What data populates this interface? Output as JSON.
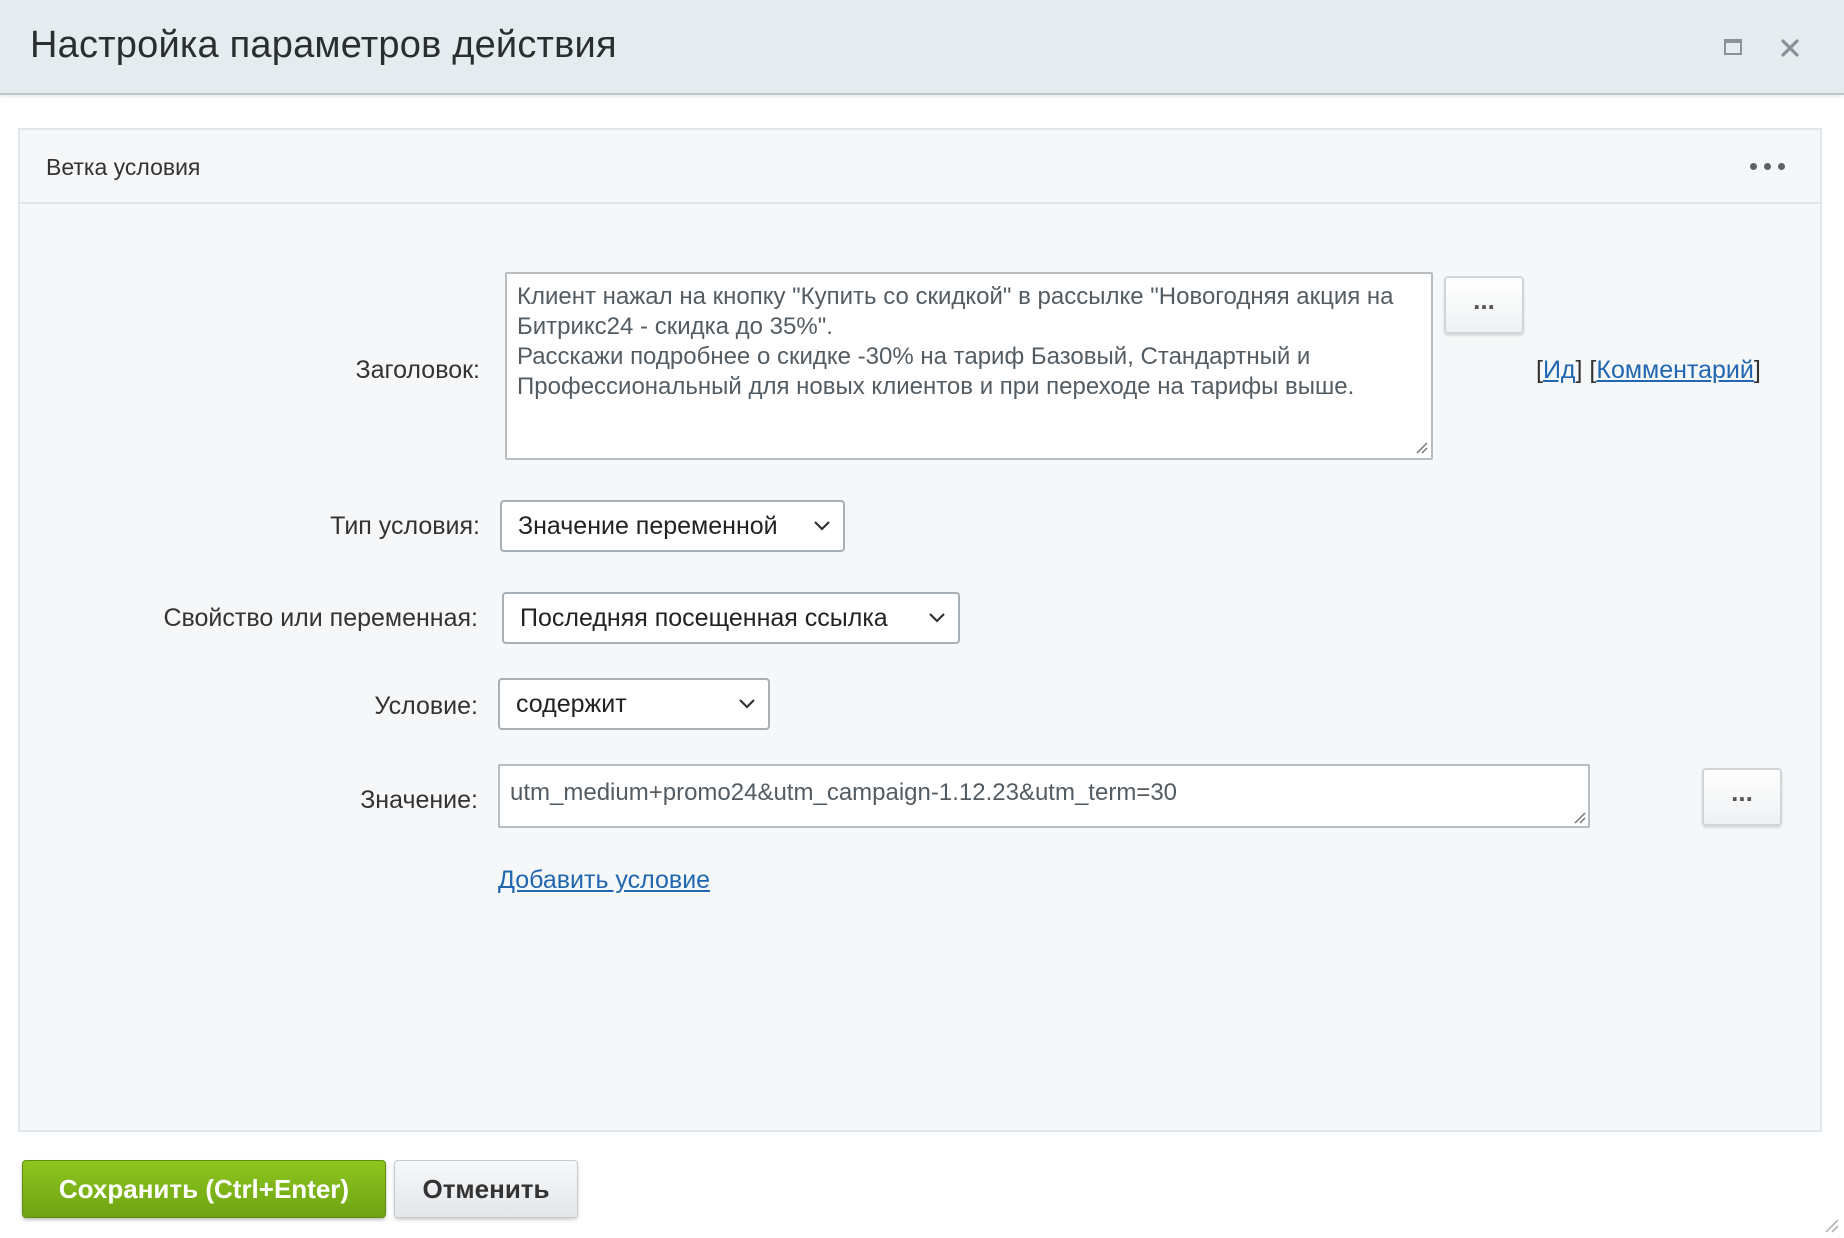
{
  "dialog": {
    "title": "Настройка параметров действия"
  },
  "panel": {
    "title": "Ветка условия"
  },
  "form": {
    "heading_label": "Заголовок:",
    "heading_value": "Клиент нажал на кнопку \"Купить со скидкой\" в рассылке \"Новогодняя акция на Битрикс24 - скидка до 35%\".\nРасскажи подробнее о скидке -30% на тариф Базовый, Стандартный и Профессиональный для новых клиентов и при переходе на тарифы выше.",
    "heading_dots": "...",
    "link_id": "Ид",
    "link_comment": "Комментарий",
    "bracket_open": "[",
    "bracket_close": "]",
    "condition_type_label": "Тип условия:",
    "condition_type_value": "Значение переменной",
    "property_label": "Свойство или переменная:",
    "property_value": "Последняя посещенная ссылка",
    "condition_label": "Условие:",
    "condition_value": "содержит",
    "value_label": "Значение:",
    "value_value": "utm_medium+promo24&utm_campaign-1.12.23&utm_term=30",
    "value_dots": "...",
    "add_condition": "Добавить условие"
  },
  "footer": {
    "save_label": "Сохранить (Ctrl+Enter)",
    "cancel_label": "Отменить"
  },
  "colors": {
    "titlebar_bg": "#e5ecef",
    "panel_bg": "#f5f7f8",
    "link": "#2067b0",
    "save_button": "#7cb518"
  },
  "icons": {
    "maximize": "maximize-icon",
    "close": "close-icon",
    "more": "more-dots-icon",
    "chevron": "chevron-down-icon"
  }
}
